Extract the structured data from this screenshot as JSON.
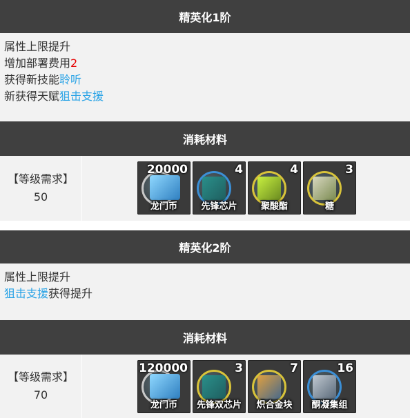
{
  "elite1": {
    "title": "精英化1阶",
    "lines": {
      "l1": "属性上限提升",
      "l2_prefix": "增加部署费用",
      "l2_value": "2",
      "l3_prefix": "获得新技能",
      "l3_link": "聆听",
      "l4_prefix": "新获得天赋",
      "l4_link": "狙击支援"
    },
    "materials_title": "消耗材料",
    "level_label": "【等级需求】",
    "level_value": "50",
    "items": [
      {
        "name": "龙门币",
        "qty": "20000",
        "icon": "lmd-icon"
      },
      {
        "name": "先锋芯片",
        "qty": "4",
        "icon": "vanguard-chip-icon"
      },
      {
        "name": "聚酸酯",
        "qty": "4",
        "icon": "polyester-icon"
      },
      {
        "name": "糖",
        "qty": "3",
        "icon": "sugar-icon"
      }
    ]
  },
  "elite2": {
    "title": "精英化2阶",
    "lines": {
      "l1": "属性上限提升",
      "l2_link": "狙击支援",
      "l2_suffix": "获得提升"
    },
    "materials_title": "消耗材料",
    "level_label": "【等级需求】",
    "level_value": "70",
    "items": [
      {
        "name": "龙门币",
        "qty": "120000",
        "icon": "lmd-icon"
      },
      {
        "name": "先锋双芯片",
        "qty": "3",
        "icon": "vanguard-dualchip-icon"
      },
      {
        "name": "炽合金块",
        "qty": "7",
        "icon": "incandescent-alloy-block-icon"
      },
      {
        "name": "酮凝集组",
        "qty": "16",
        "icon": "keton-colloid-icon"
      }
    ]
  },
  "colors": {
    "header_bg": "#404040",
    "panel_bg": "#f2f2f2",
    "red": "#e60000",
    "link_blue": "#29a3e6"
  }
}
